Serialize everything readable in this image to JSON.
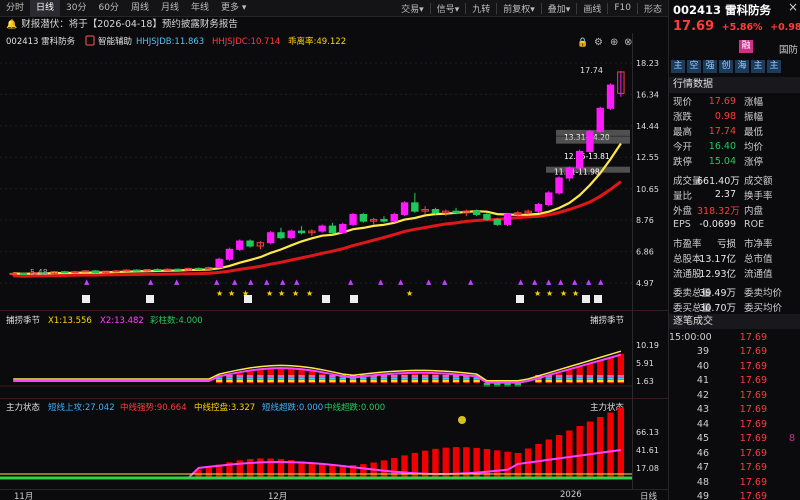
{
  "toolbar": {
    "tabs": [
      {
        "label": "分时"
      },
      {
        "label": "日线",
        "active": true
      },
      {
        "label": "30分"
      },
      {
        "label": "60分"
      },
      {
        "label": "周线"
      },
      {
        "label": "月线"
      },
      {
        "label": "年线"
      },
      {
        "label": "更多"
      }
    ],
    "menus": [
      "交易",
      "信号",
      "九转",
      "前复权",
      "叠加",
      "画线",
      "F10",
      "形态"
    ]
  },
  "notice": {
    "text": "财报潜伏：将于【2026-04-18】预约披露财务报告"
  },
  "main_chart": {
    "code_name": "002413 雷科防务",
    "indicator_name": "智能辅助",
    "readouts": [
      {
        "label": "HHJSJDB:11.863",
        "color": "#4fc3f7"
      },
      {
        "label": "HHJSJDC:10.714",
        "color": "#ff3b3b"
      },
      {
        "label": "乖离率:49.122",
        "color": "#ffd400"
      }
    ],
    "price_axis": [
      "18.23",
      "16.34",
      "14.44",
      "12.55",
      "10.65",
      "8.76",
      "6.86",
      "4.97"
    ],
    "price_ticks": [
      18.23,
      16.34,
      14.44,
      12.55,
      10.65,
      8.76,
      6.86,
      4.97
    ],
    "high_label": "17.74",
    "low_label": "5.48",
    "zone_labels": [
      "13.31-14.20",
      "12.55-13.81",
      "11.41-11.98"
    ],
    "icons": [
      "lock-icon",
      "settings-icon",
      "add-icon",
      "close-icon"
    ]
  },
  "sub1": {
    "name": "捕捞季节",
    "readouts": [
      {
        "label": "X1:13.556",
        "color": "#ffd400"
      },
      {
        "label": "X2:13.482",
        "color": "#ff40ff"
      },
      {
        "label": "彩柱数:4.000",
        "color": "#1fc95a"
      }
    ],
    "right_name": "捕捞季节",
    "axis": [
      "10.19",
      "5.91",
      "1.63"
    ]
  },
  "sub2": {
    "name": "主力状态",
    "readouts": [
      {
        "label": "短线上攻:27.042",
        "color": "#3db0ff"
      },
      {
        "label": "中线强势:90.664",
        "color": "#ff3b3b"
      },
      {
        "label": "中线控盘:3.327",
        "color": "#ffd400"
      },
      {
        "label": "短线超跌:0.000",
        "color": "#3db0ff"
      },
      {
        "label": "中线超跌:0.000",
        "color": "#1fc95a"
      }
    ],
    "right_name": "主力状态",
    "axis": [
      "66.13",
      "41.61",
      "17.08"
    ]
  },
  "date_axis": [
    "11月",
    "12月",
    "2026"
  ],
  "period_label": "日线",
  "panel": {
    "code": "002413 雷科防务",
    "price": "17.69",
    "change_pct": "+5.86%",
    "change": "+0.98",
    "rong": "融",
    "category": "国防",
    "tags": [
      "主",
      "空",
      "强",
      "创",
      "海",
      "主",
      "主"
    ],
    "section_title": "行情数据",
    "quote_rows": [
      {
        "l1": "现价",
        "v1": "17.69",
        "c1": "red",
        "l2": "涨幅"
      },
      {
        "l1": "涨跌",
        "v1": "0.98",
        "c1": "red",
        "l2": "振幅"
      },
      {
        "l1": "最高",
        "v1": "17.74",
        "c1": "red",
        "l2": "最低"
      },
      {
        "l1": "今开",
        "v1": "16.40",
        "c1": "green",
        "l2": "均价"
      },
      {
        "l1": "跌停",
        "v1": "15.04",
        "c1": "green",
        "l2": "涨停"
      },
      {
        "sep": true
      },
      {
        "l1": "成交量",
        "v1": "661.40万",
        "c1": "white",
        "l2": "成交额"
      },
      {
        "l1": "量比",
        "v1": "2.37",
        "c1": "white",
        "l2": "换手率"
      },
      {
        "l1": "外盘",
        "v1": "318.32万",
        "c1": "red",
        "l2": "内盘"
      },
      {
        "l1": "EPS",
        "v1": "-0.0699",
        "c1": "white",
        "l2": "ROE"
      },
      {
        "sep": true
      },
      {
        "l1": "市盈率",
        "v1": "亏损",
        "c1": "white",
        "l2": "市净率"
      },
      {
        "l1": "总股本",
        "v1": "13.17亿",
        "c1": "white",
        "l2": "总市值"
      },
      {
        "l1": "流通股",
        "v1": "12.93亿",
        "c1": "white",
        "l2": "流通值"
      },
      {
        "sep": true
      },
      {
        "l1": "委卖总量",
        "v1": "39.49万",
        "c1": "white",
        "l2": "委卖均价"
      },
      {
        "l1": "委买总量",
        "v1": "30.70万",
        "c1": "white",
        "l2": "委买均价"
      }
    ],
    "ticks_title": "逐笔成交",
    "ticks": [
      {
        "t": "15:00:00",
        "p": "17.69"
      },
      {
        "t": "39",
        "p": "17.69"
      },
      {
        "t": "40",
        "p": "17.69"
      },
      {
        "t": "41",
        "p": "17.69"
      },
      {
        "t": "42",
        "p": "17.69"
      },
      {
        "t": "43",
        "p": "17.69"
      },
      {
        "t": "44",
        "p": "17.69"
      },
      {
        "t": "45",
        "p": "17.69",
        "extra": "8"
      },
      {
        "t": "46",
        "p": "17.69"
      },
      {
        "t": "47",
        "p": "17.69"
      },
      {
        "t": "48",
        "p": "17.69"
      },
      {
        "t": "49",
        "p": "17.69"
      }
    ]
  }
}
